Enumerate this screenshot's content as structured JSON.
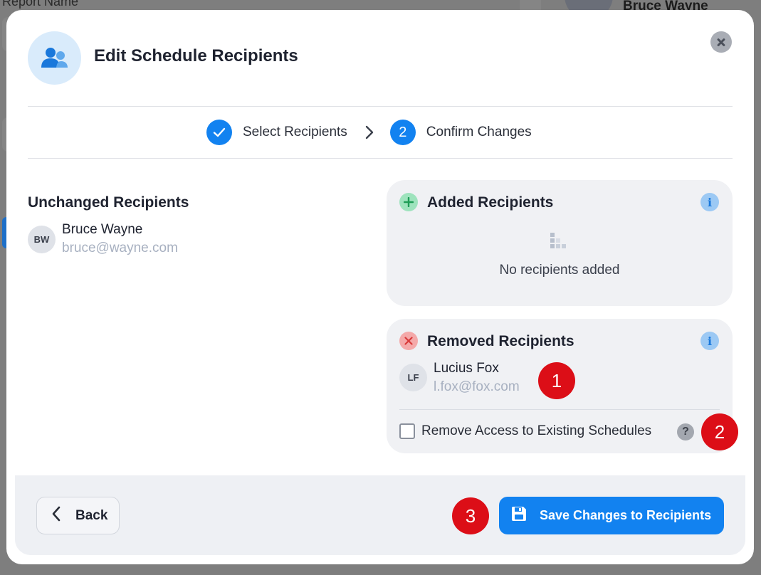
{
  "background": {
    "report_name_label": "Report Name",
    "user_name": "Bruce Wayne"
  },
  "modal": {
    "title": "Edit Schedule Recipients",
    "header_icon": "users-icon",
    "close_icon": "close-icon"
  },
  "stepper": {
    "steps": [
      {
        "number": "1",
        "label": "Select Recipients",
        "state": "completed"
      },
      {
        "number": "2",
        "label": "Confirm Changes",
        "state": "active"
      }
    ],
    "separator_icon": "chevron-right-icon"
  },
  "unchanged": {
    "title": "Unchanged Recipients",
    "recipients": [
      {
        "initials": "BW",
        "name": "Bruce Wayne",
        "email": "bruce@wayne.com"
      }
    ]
  },
  "added": {
    "title": "Added Recipients",
    "empty_text": "No recipients added",
    "status_icon": "plus-circle-icon",
    "info_icon_glyph": "i"
  },
  "removed": {
    "title": "Removed Recipients",
    "status_icon": "x-circle-icon",
    "info_icon_glyph": "i",
    "recipients": [
      {
        "initials": "LF",
        "name": "Lucius Fox",
        "email": "l.fox@fox.com"
      }
    ],
    "remove_access_label": "Remove Access to Existing Schedules",
    "remove_access_checked": false,
    "help_glyph": "?"
  },
  "footer": {
    "back_label": "Back",
    "save_label": "Save Changes to Recipients"
  },
  "markers": [
    "1",
    "2",
    "3"
  ],
  "colors": {
    "accent": "#1282f0",
    "marker": "#dc0e17",
    "added": "#2fbf71",
    "removed": "#e34b4b"
  }
}
